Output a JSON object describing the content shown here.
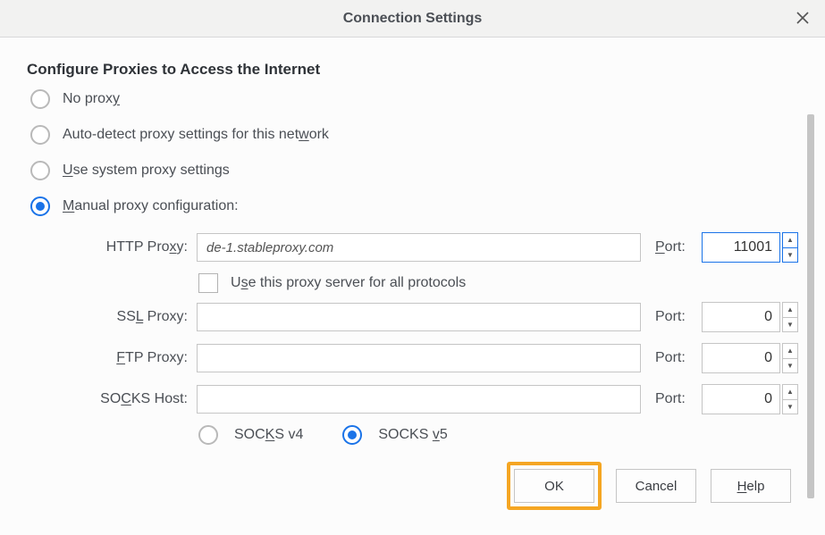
{
  "window": {
    "title": "Connection Settings"
  },
  "heading": "Configure Proxies to Access the Internet",
  "modes": {
    "no_proxy": {
      "label_pre": "No prox",
      "label_u": "y"
    },
    "auto_detect": {
      "label_pre": "Auto-detect proxy settings for this net",
      "label_u": "w",
      "label_post": "ork"
    },
    "system": {
      "label_u": "U",
      "label_post": "se system proxy settings"
    },
    "manual": {
      "label_u": "M",
      "label_post": "anual proxy configuration:"
    },
    "selected": "manual"
  },
  "fields": {
    "http": {
      "label_pre": "HTTP Pro",
      "label_u": "x",
      "label_post": "y:",
      "value": "de-1.stableproxy.com",
      "port_label_u": "P",
      "port_label_post": "ort:",
      "port": "11001"
    },
    "use_all": {
      "label_pre": "U",
      "label_u": "s",
      "label_post": "e this proxy server for all protocols",
      "checked": false
    },
    "ssl": {
      "label_pre": "SS",
      "label_u": "L",
      "label_post": " Proxy:",
      "value": "",
      "port_label": "Port:",
      "port": "0"
    },
    "ftp": {
      "label_u": "F",
      "label_post": "TP Proxy:",
      "value": "",
      "port_label": "Port:",
      "port": "0"
    },
    "socks": {
      "label_pre": "SO",
      "label_u": "C",
      "label_post": "KS Host:",
      "value": "",
      "port_label": "Port:",
      "port": "0"
    }
  },
  "socks_version": {
    "v4": {
      "label_pre": "SOC",
      "label_u": "K",
      "label_post": "S v4"
    },
    "v5": {
      "label_pre": "SOCKS ",
      "label_u": "v",
      "label_post": "5"
    },
    "selected": "v5"
  },
  "buttons": {
    "ok": "OK",
    "cancel": "Cancel",
    "help_u": "H",
    "help_post": "elp"
  }
}
